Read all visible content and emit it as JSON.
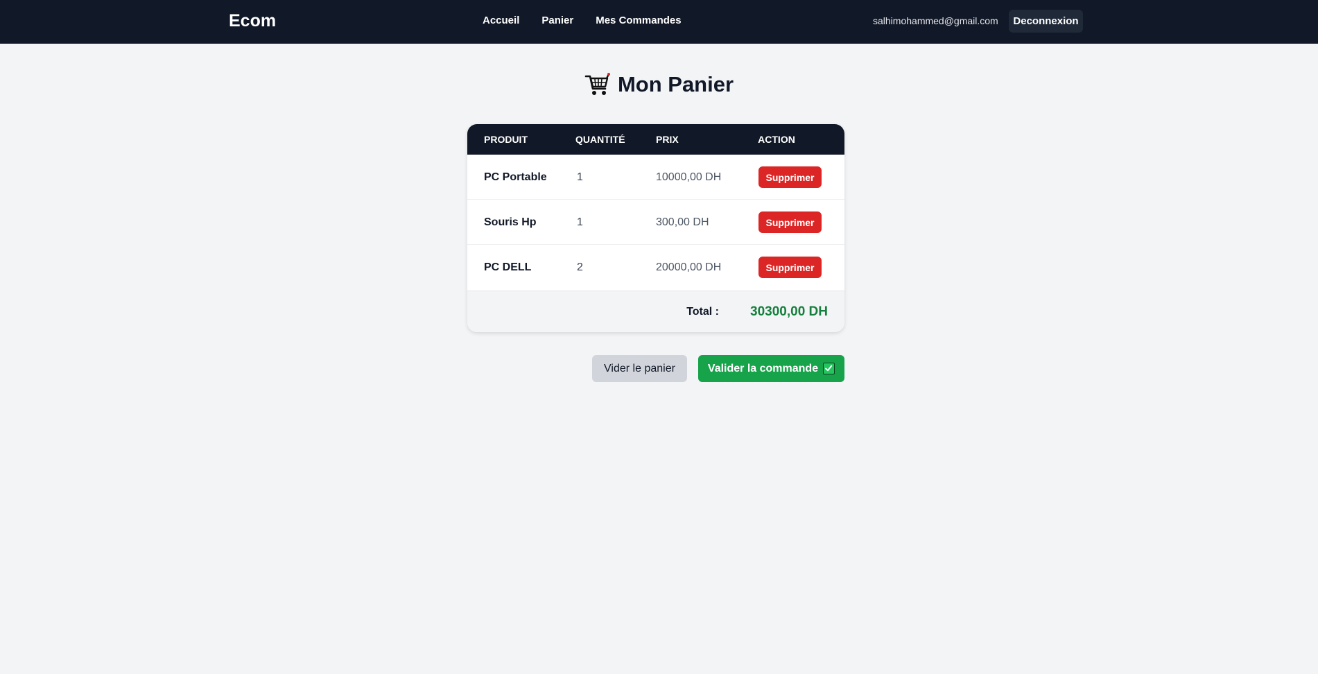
{
  "nav": {
    "brand": "Ecom",
    "links": [
      "Accueil",
      "Panier",
      "Mes Commandes"
    ],
    "email": "salhimohammed@gmail.com",
    "logout": "Deconnexion"
  },
  "page": {
    "title": "Mon Panier",
    "title_icon": "shopping-cart-icon"
  },
  "cart": {
    "headers": [
      "PRODUIT",
      "QUANTITÉ",
      "PRIX",
      "ACTION"
    ],
    "rows": [
      {
        "product": "PC Portable",
        "quantity": "1",
        "price": "10000,00 DH",
        "action": "Supprimer"
      },
      {
        "product": "Souris Hp",
        "quantity": "1",
        "price": "300,00 DH",
        "action": "Supprimer"
      },
      {
        "product": "PC DELL",
        "quantity": "2",
        "price": "20000,00 DH",
        "action": "Supprimer"
      }
    ],
    "total_label": "Total :",
    "total_value": "30300,00 DH"
  },
  "actions": {
    "empty": "Vider le panier",
    "validate": "Valider la commande",
    "validate_icon": "check-box-icon"
  },
  "colors": {
    "navbar": "#111827",
    "delete": "#dc2626",
    "validate": "#16a34a",
    "total": "#15803d"
  }
}
